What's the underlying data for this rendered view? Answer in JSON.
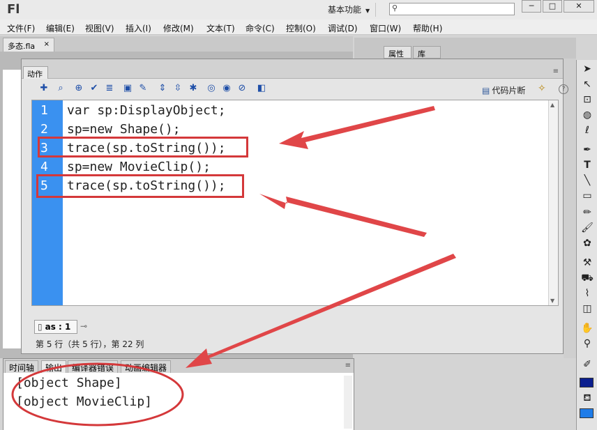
{
  "app": {
    "logo": "Fl",
    "workspace": "基本功能"
  },
  "window_controls": {
    "minimize": "─",
    "maximize": "□",
    "close": "✕"
  },
  "menu": [
    "文件(F)",
    "编辑(E)",
    "视图(V)",
    "插入(I)",
    "修改(M)",
    "文本(T)",
    "命令(C)",
    "控制(O)",
    "调试(D)",
    "窗口(W)",
    "帮助(H)"
  ],
  "document_tab": {
    "name": "多态.fla",
    "close": "×"
  },
  "right_panel": {
    "tabs": [
      "属性",
      "库"
    ]
  },
  "actions_panel": {
    "tab": "动作",
    "snippets_label": "代码片断",
    "code": [
      {
        "n": "1",
        "text": "var sp:DisplayObject;"
      },
      {
        "n": "2",
        "text": "sp=new Shape();"
      },
      {
        "n": "3",
        "text": "trace(sp.toString());"
      },
      {
        "n": "4",
        "text": "sp=new MovieClip();"
      },
      {
        "n": "5",
        "text": "trace(sp.toString());"
      }
    ],
    "script_tab": "as : 1",
    "status": "第 5 行（共 5 行），第 22 列"
  },
  "output_panel": {
    "tabs": [
      "时间轴",
      "输出",
      "编译器错误",
      "动画编辑器"
    ],
    "lines": [
      "[object Shape]",
      "[object MovieClip]"
    ]
  },
  "colors": {
    "gutter": "#3a91f0",
    "annotation": "#d4383a",
    "stroke": "#0b1f8f",
    "fill": "#1f7ce8"
  },
  "icons": [
    "add-script-icon",
    "find-icon",
    "target-icon",
    "check-syntax-icon",
    "format-icon",
    "hints-icon",
    "debug-icon",
    "collapse-icon",
    "collapse-selection-icon",
    "expand-icon",
    "comment-block-icon",
    "comment-line-icon",
    "uncomment-icon",
    "script-assist-icon",
    "code-snippets-icon",
    "wand-icon",
    "help-icon"
  ]
}
